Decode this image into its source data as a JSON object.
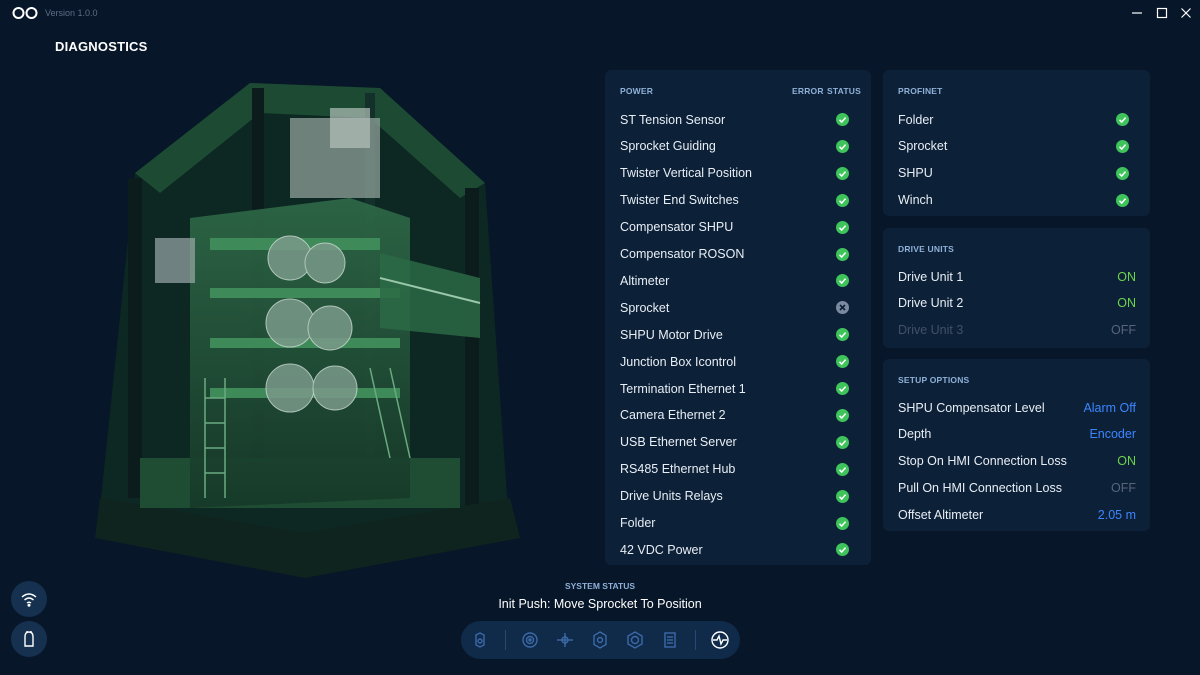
{
  "app": {
    "version": "Version 1.0.0",
    "page_title": "DIAGNOSTICS"
  },
  "colors": {
    "background": "#071628",
    "panel": "#0c2038",
    "ok_green": "#3ec45a",
    "on_green": "#6ed24a",
    "accent_blue": "#3b86ff",
    "error_grey": "#7b8aa0"
  },
  "power": {
    "header": "POWER",
    "col_error": "ERROR",
    "col_status": "STATUS",
    "items": [
      {
        "label": "ST Tension Sensor",
        "status": "ok"
      },
      {
        "label": "Sprocket Guiding",
        "status": "ok"
      },
      {
        "label": "Twister Vertical Position",
        "status": "ok"
      },
      {
        "label": "Twister End Switches",
        "status": "ok"
      },
      {
        "label": "Compensator SHPU",
        "status": "ok"
      },
      {
        "label": "Compensator ROSON",
        "status": "ok"
      },
      {
        "label": "Altimeter",
        "status": "ok"
      },
      {
        "label": "Sprocket",
        "status": "error"
      },
      {
        "label": "SHPU Motor Drive",
        "status": "ok"
      },
      {
        "label": "Junction Box Icontrol",
        "status": "ok"
      },
      {
        "label": "Termination Ethernet 1",
        "status": "ok"
      },
      {
        "label": "Camera Ethernet 2",
        "status": "ok"
      },
      {
        "label": "USB Ethernet Server",
        "status": "ok"
      },
      {
        "label": "RS485 Ethernet Hub",
        "status": "ok"
      },
      {
        "label": "Drive Units Relays",
        "status": "ok"
      },
      {
        "label": "Folder",
        "status": "ok"
      },
      {
        "label": "42 VDC Power",
        "status": "ok"
      }
    ]
  },
  "profinet": {
    "header": "PROFINET",
    "items": [
      {
        "label": "Folder",
        "status": "ok"
      },
      {
        "label": "Sprocket",
        "status": "ok"
      },
      {
        "label": "SHPU",
        "status": "ok"
      },
      {
        "label": "Winch",
        "status": "ok"
      }
    ]
  },
  "drive_units": {
    "header": "DRIVE UNITS",
    "items": [
      {
        "label": "Drive Unit 1",
        "value": "ON",
        "state": "on"
      },
      {
        "label": "Drive Unit 2",
        "value": "ON",
        "state": "on"
      },
      {
        "label": "Drive Unit 3",
        "value": "OFF",
        "state": "disabled"
      }
    ]
  },
  "setup_options": {
    "header": "SETUP OPTIONS",
    "items": [
      {
        "label": "SHPU Compensator Level",
        "value": "Alarm Off",
        "style": "blue"
      },
      {
        "label": "Depth",
        "value": "Encoder",
        "style": "blue"
      },
      {
        "label": "Stop On HMI Connection Loss",
        "value": "ON",
        "style": "on"
      },
      {
        "label": "Pull On HMI Connection Loss",
        "value": "OFF",
        "style": "off"
      },
      {
        "label": "Offset Altimeter",
        "value": "2.05 m",
        "style": "blue"
      }
    ]
  },
  "system_status": {
    "header": "SYSTEM STATUS",
    "text": "Init Push: Move Sprocket To Position"
  },
  "toolbar": {
    "items": [
      "device-icon",
      "target-icon",
      "pan-icon",
      "settings-icon",
      "camera-icon",
      "log-icon",
      "diagnostics-icon"
    ],
    "active": "diagnostics-icon"
  },
  "side_buttons": [
    "wifi-icon",
    "bell-icon"
  ]
}
